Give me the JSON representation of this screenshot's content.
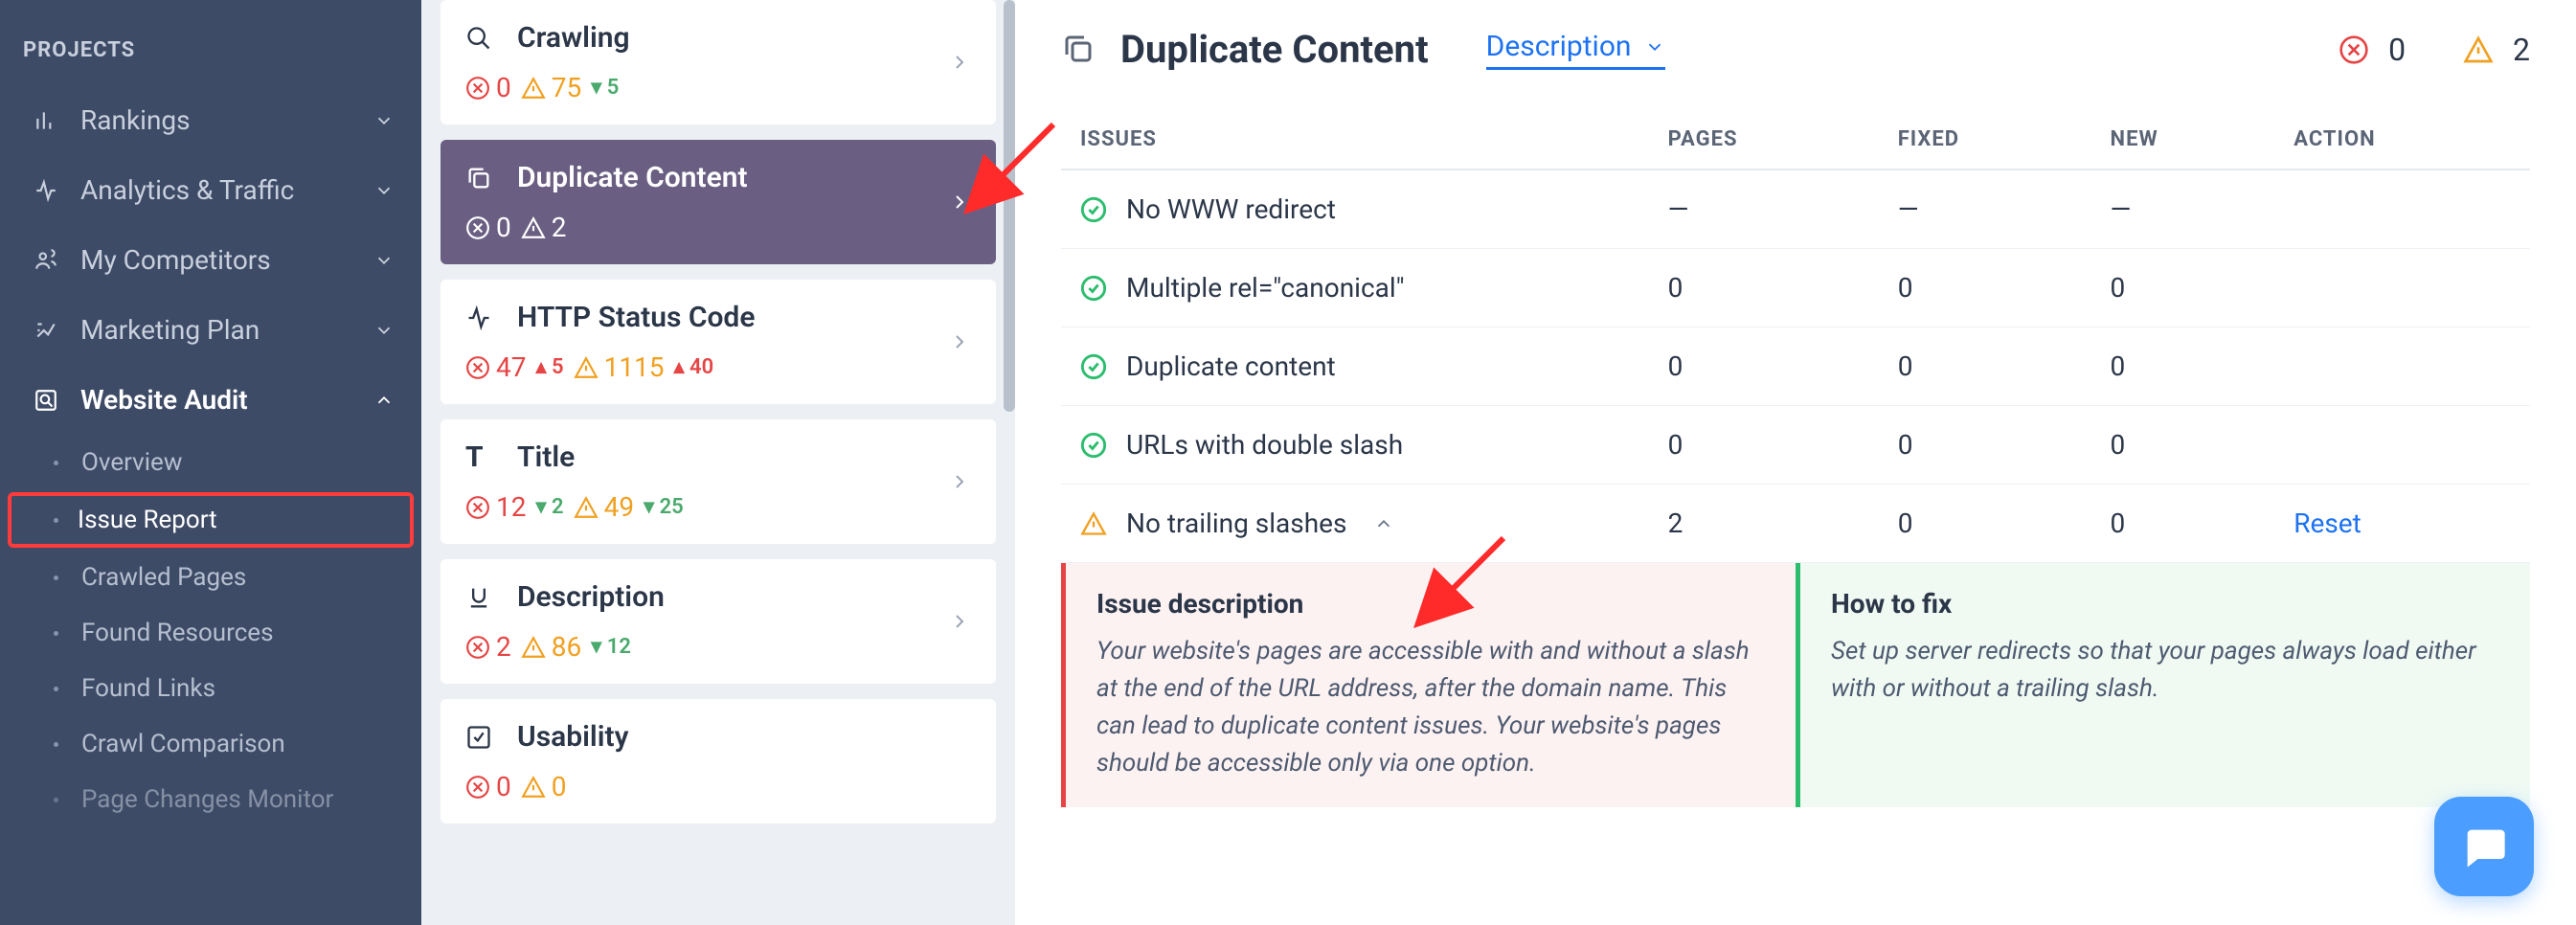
{
  "sidebar": {
    "header": "PROJECTS",
    "items": [
      {
        "label": "Rankings",
        "icon": "bars"
      },
      {
        "label": "Analytics & Traffic",
        "icon": "pulse"
      },
      {
        "label": "My Competitors",
        "icon": "people"
      },
      {
        "label": "Marketing Plan",
        "icon": "plan"
      },
      {
        "label": "Website Audit",
        "icon": "audit",
        "expanded": true,
        "children": [
          {
            "label": "Overview"
          },
          {
            "label": "Issue Report",
            "highlighted": true
          },
          {
            "label": "Crawled Pages"
          },
          {
            "label": "Found Resources"
          },
          {
            "label": "Found Links"
          },
          {
            "label": "Crawl Comparison"
          },
          {
            "label": "Page Changes Monitor"
          }
        ]
      }
    ]
  },
  "cards": [
    {
      "title": "Crawling",
      "icon": "search",
      "active": false,
      "err": "0",
      "warn": "75",
      "delta": "▾ 5",
      "deltaDir": "down"
    },
    {
      "title": "Duplicate Content",
      "icon": "copy",
      "active": true,
      "err": "0",
      "warn": "2"
    },
    {
      "title": "HTTP Status Code",
      "icon": "pulse",
      "active": false,
      "err": "47",
      "errDelta": "▴ 5",
      "errDeltaDir": "up",
      "warn": "1115",
      "warnDelta": "▴ 40",
      "warnDeltaDir": "up"
    },
    {
      "title": "Title",
      "icon": "T",
      "active": false,
      "err": "12",
      "errDelta": "▾ 2",
      "errDeltaDir": "down",
      "warn": "49",
      "warnDelta": "▾ 25",
      "warnDeltaDir": "down"
    },
    {
      "title": "Description",
      "icon": "underline",
      "active": false,
      "err": "2",
      "warn": "86",
      "warnDelta": "▾ 12",
      "warnDeltaDir": "down"
    },
    {
      "title": "Usability",
      "icon": "check",
      "active": false,
      "err": "0",
      "warn": "0"
    }
  ],
  "main": {
    "title": "Duplicate Content",
    "dropdown": "Description",
    "headErr": "0",
    "headWarn": "2",
    "columns": {
      "issues": "ISSUES",
      "pages": "PAGES",
      "fixed": "FIXED",
      "new": "NEW",
      "action": "ACTION"
    },
    "rows": [
      {
        "status": "ok",
        "name": "No WWW redirect",
        "pages": "—",
        "fixed": "—",
        "new": "—"
      },
      {
        "status": "ok",
        "name": "Multiple rel=\"canonical\"",
        "pages": "0",
        "fixed": "0",
        "new": "0"
      },
      {
        "status": "ok",
        "name": "Duplicate content",
        "pages": "0",
        "fixed": "0",
        "new": "0"
      },
      {
        "status": "ok",
        "name": "URLs with double slash",
        "pages": "0",
        "fixed": "0",
        "new": "0"
      },
      {
        "status": "warn",
        "name": "No trailing slashes",
        "pages": "2",
        "fixed": "0",
        "new": "0",
        "action": "Reset",
        "expanded": true
      }
    ],
    "detail": {
      "leftTitle": "Issue description",
      "leftText": "Your website's pages are accessible with and without a slash at the end of the URL address, after the domain name. This can lead to duplicate content issues. Your website's pages should be accessible only via one option.",
      "rightTitle": "How to fix",
      "rightText": "Set up server redirects so that your pages always load either with or without a trailing slash."
    }
  }
}
